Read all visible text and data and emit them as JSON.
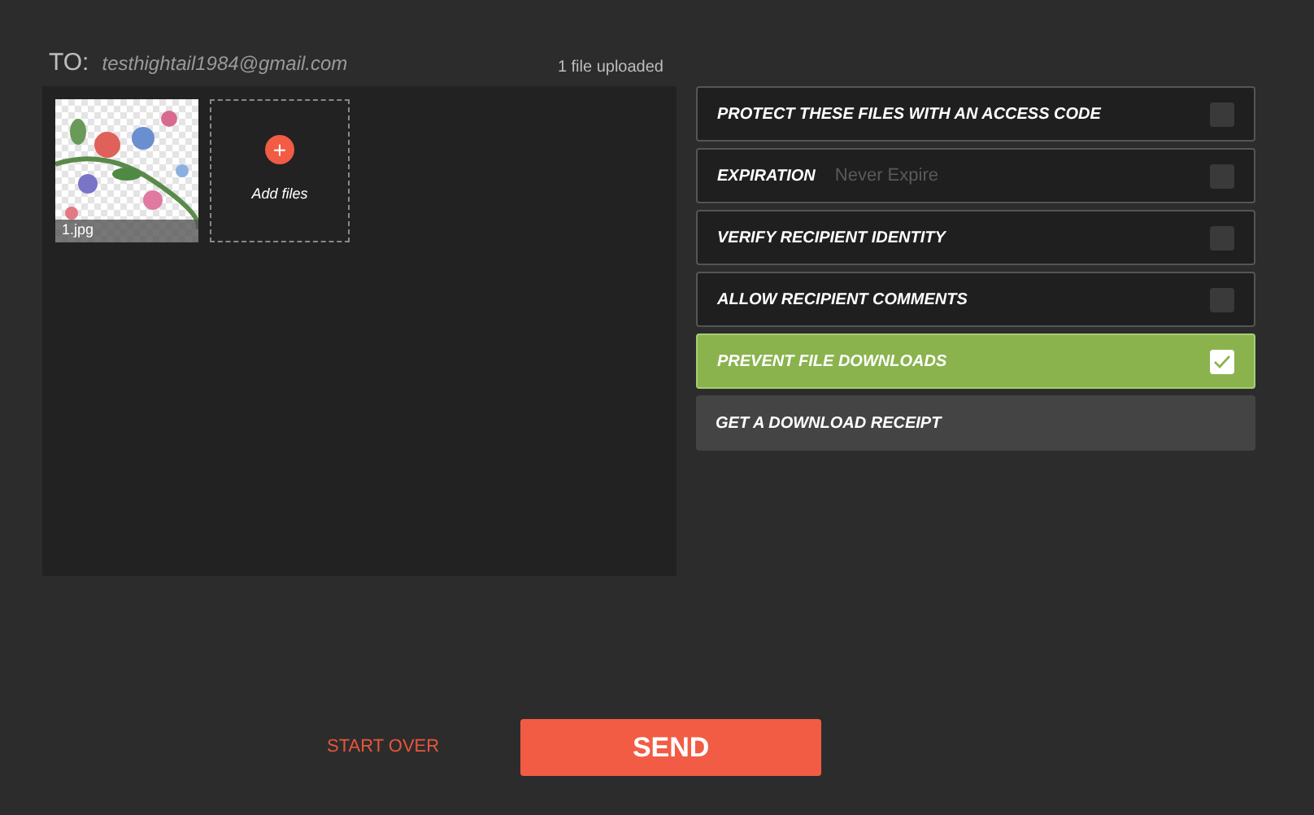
{
  "recipient": {
    "label": "TO:",
    "value": "testhightail1984@gmail.com"
  },
  "upload_status": "1 file uploaded",
  "files": [
    {
      "kind": "picture",
      "name": "1.jpg"
    }
  ],
  "add_files": {
    "label": "Add files",
    "icon": "+"
  },
  "options": [
    {
      "kind": "checkbox",
      "label": "PROTECT THESE FILES WITH AN ACCESS CODE",
      "checked": false
    },
    {
      "kind": "checkbox",
      "label": "EXPIRATION",
      "value": "Never Expire",
      "checked": false
    },
    {
      "kind": "checkbox",
      "label": "VERIFY RECIPIENT IDENTITY",
      "checked": false
    },
    {
      "kind": "checkbox",
      "label": "ALLOW RECIPIENT COMMENTS",
      "checked": false
    },
    {
      "kind": "checkbox",
      "label": "PREVENT FILE DOWNLOADS",
      "checked": true
    },
    {
      "kind": "action",
      "label": "GET A DOWNLOAD RECEIPT"
    }
  ],
  "start_over": "START OVER",
  "send": "SEND"
}
